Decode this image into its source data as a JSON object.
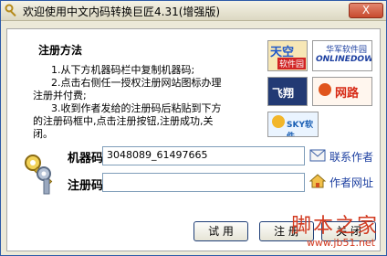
{
  "window": {
    "title": "欢迎使用中文内码转换巨匠4.31(增强版)",
    "close_label": "X"
  },
  "instructions": {
    "title": "注册方法",
    "lines": [
      "1.从下方机器码栏中复制机器码;",
      "2.点击右侧任一授权注册网站图标办理",
      "注册并付费;",
      "3.收到作者发给的注册码后粘贴到下方",
      "的注册码框中,点击注册按钮,注册成功,关",
      "闭。"
    ]
  },
  "logos": {
    "tianji": "天空",
    "tianji_sub": "软件园",
    "huajun": "华军软件园",
    "huajun_sub": "ONLINEDOWN",
    "feixiang": "飞翔",
    "wanglu": "网路",
    "soft": "SKY软件"
  },
  "form": {
    "machine_code_label": "机器码",
    "machine_code_value": "3048089_61497665",
    "register_code_label": "注册码",
    "register_code_value": ""
  },
  "links": {
    "contact": "联系作者",
    "website": "作者网址"
  },
  "buttons": {
    "trial": "试 用",
    "register": "注 册",
    "close": "关 闭"
  },
  "watermark": {
    "title": "脚本之家",
    "url": "www.jb51.net"
  }
}
